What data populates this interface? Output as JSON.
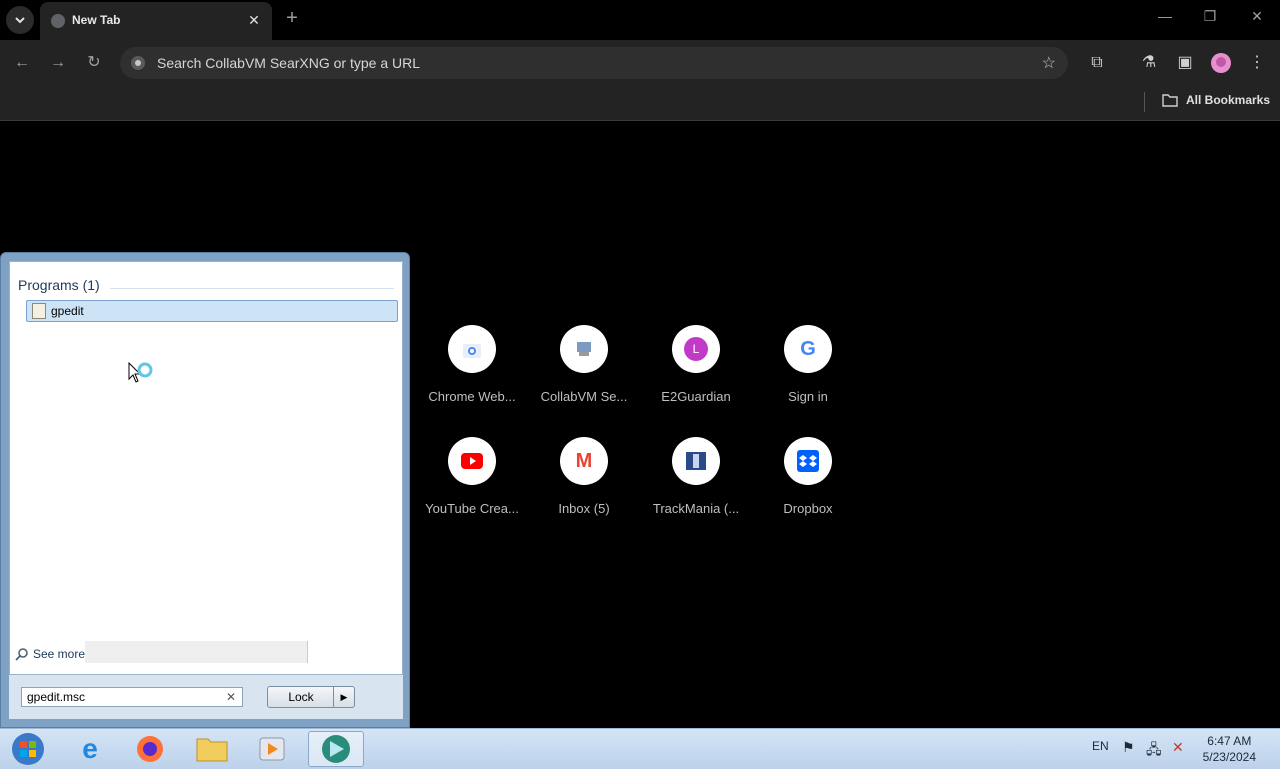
{
  "browser": {
    "tab_title": "New Tab",
    "omnibox_placeholder": "Search CollabVM SearXNG or type a URL",
    "bookmarks_all": "All Bookmarks"
  },
  "shortcuts": [
    {
      "label": "Chrome Web...",
      "icon": "chrome-web-store-icon"
    },
    {
      "label": "CollabVM Se...",
      "icon": "collabvm-icon"
    },
    {
      "label": "E2Guardian",
      "icon": "letter-l-icon",
      "letter": "L"
    },
    {
      "label": "Sign in",
      "icon": "google-icon",
      "letter": "G"
    },
    {
      "label": "YouTube Crea...",
      "icon": "youtube-icon"
    },
    {
      "label": "Inbox (5)",
      "icon": "gmail-icon",
      "letter": "M"
    },
    {
      "label": "TrackMania (...",
      "icon": "trackmania-icon"
    },
    {
      "label": "Dropbox",
      "icon": "dropbox-icon"
    }
  ],
  "start_menu": {
    "programs_heading": "Programs (1)",
    "program_item": "gpedit",
    "see_more": "See more",
    "search_value": "gpedit.msc",
    "lock_label": "Lock"
  },
  "taskbar": {
    "language": "EN",
    "time": "6:47 AM",
    "date": "5/23/2024"
  },
  "colors": {
    "accent": "#8ab4f8",
    "taskbar": "#c8dbef",
    "start_menu_frame": "#7fa2c4"
  }
}
